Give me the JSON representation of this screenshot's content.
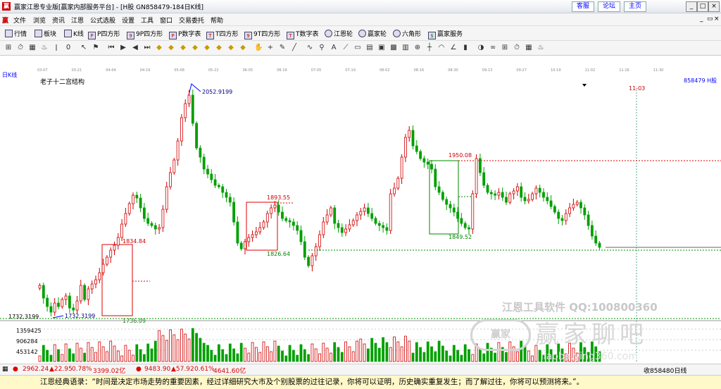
{
  "window": {
    "title": "赢家江恩专业版[赢家内部服务平台] - [H股  GN858479-184日K线]",
    "links": [
      "客服",
      "论坛",
      "主页"
    ]
  },
  "menu": [
    "文件",
    "浏览",
    "资讯",
    "江恩",
    "公式选股",
    "设置",
    "工具",
    "窗口",
    "交易委托",
    "帮助"
  ],
  "toolbar1": [
    "行情",
    "板块",
    "K线",
    "P四方形",
    "9P四方形",
    "P数字表",
    "T四方形",
    "9T四方形",
    "T数字表",
    "江恩轮",
    "赢家轮",
    "六角形",
    "赢家服务"
  ],
  "toolbar2_icons": [
    "grid-icon",
    "clock-icon",
    "calendar-icon",
    "tick-chart-icon",
    "kline-icon",
    "zero-icon",
    "cursor-icon",
    "flag-icon",
    "rewind-icon",
    "play-icon",
    "prev-icon",
    "first-icon",
    "up-icon",
    "down-icon",
    "left-icon",
    "right-icon",
    "diamond1-icon",
    "diamond2-icon",
    "diamond3-icon",
    "diamond4-icon",
    "diamond5-icon",
    "diamond6-icon",
    "diamond7-icon",
    "diamond8-icon",
    "hand-icon",
    "crosshair-icon",
    "pen-icon",
    "line-icon",
    "wave-icon",
    "magnet-icon",
    "text-icon",
    "fan-icon",
    "box-icon",
    "table-icon",
    "calc-icon",
    "save-icon",
    "print-icon",
    "zoom-icon",
    "ruler-icon",
    "arc-icon",
    "angle-icon",
    "bars-icon",
    "pie-icon",
    "infinity-icon"
  ],
  "time_axis": [
    "03-07",
    "03-21",
    "04-04",
    "04-19",
    "05-08",
    "05-22",
    "06-05",
    "06-19",
    "07-05",
    "07-19",
    "08-02",
    "08-16",
    "08-30",
    "09-13",
    "09-27",
    "10-19",
    "11-02",
    "11-16",
    "11-30"
  ],
  "header": {
    "period": "日K线",
    "study": "老子十二宫结构",
    "code": "858479",
    "market": "H股",
    "future_date": "11-03"
  },
  "price_labels": {
    "high": "2052.9199",
    "start_low": "1732.3199",
    "axis_left": "1732.3199",
    "box1_top": "1834.84",
    "box1_bottom": "1736.09",
    "box2_top": "1893.55",
    "box2_bottom": "1826.64",
    "box3_top": "1950.08",
    "box3_bottom": "1849.52"
  },
  "volume_axis": [
    "1359425",
    "906284",
    "453142"
  ],
  "watermark": {
    "line1": "江恩工具软件  QQ:100800360",
    "logo": "赢家",
    "brand": "赢家聊吧",
    "sub": "liaoba.ying360.com"
  },
  "status": {
    "idx1": "2962.24",
    "idx1_chg": "▲22.95",
    "idx1_pct": "0.78%",
    "idx1_amt": "3399.02亿",
    "idx2": "9483.90",
    "idx2_chg": "▲57.92",
    "idx2_pct": "0.61%",
    "idx2_amt": "4641.60亿",
    "right": "收858480日线"
  },
  "quote": "江恩经典语录：“时间是决定市场走势的重要因素，经过详细研究大市及个别股票的过往记录，你将可以证明，历史确实重复发生；而了解过往，你将可以预测将来。”。",
  "colors": {
    "up": "#d00000",
    "down": "#00a000",
    "grid": "#cccccc"
  }
}
